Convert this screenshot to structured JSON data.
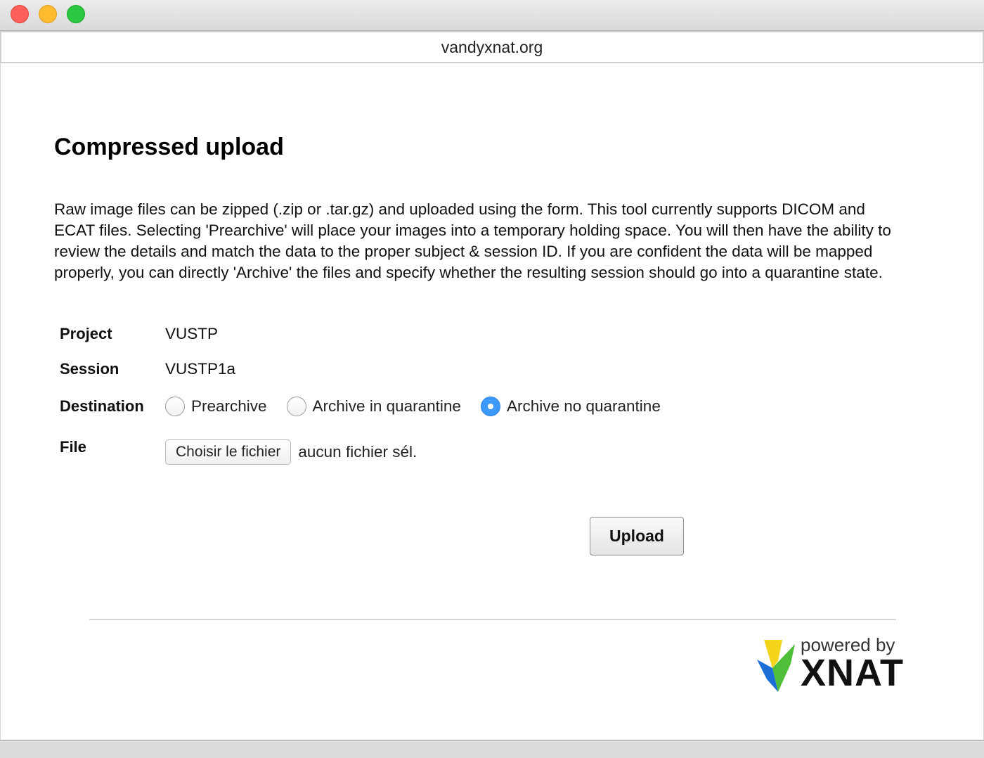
{
  "browser": {
    "url": "vandyxnat.org"
  },
  "page": {
    "title": "Compressed upload",
    "description": "Raw image files can be zipped (.zip or .tar.gz) and uploaded using the form. This tool currently supports DICOM and ECAT files. Selecting 'Prearchive' will place your images into a temporary holding space. You will then have the ability to review the details and match the data to the proper subject & session ID. If you are confident the data will be mapped properly, you can directly 'Archive' the files and specify whether the resulting session should go into a quarantine state."
  },
  "form": {
    "project_label": "Project",
    "project_value": "VUSTP",
    "session_label": "Session",
    "session_value": "VUSTP1a",
    "destination_label": "Destination",
    "destination_options": [
      {
        "label": "Prearchive",
        "checked": false
      },
      {
        "label": "Archive in quarantine",
        "checked": false
      },
      {
        "label": "Archive no quarantine",
        "checked": true
      }
    ],
    "file_label": "File",
    "file_button": "Choisir le fichier",
    "file_status": "aucun fichier sél.",
    "upload_button": "Upload"
  },
  "footer": {
    "powered_by": "powered by",
    "brand": "XNAT"
  },
  "colors": {
    "radio_selected": "#3b99fc",
    "logo_yellow": "#f4d41b",
    "logo_green": "#4fbf3a",
    "logo_blue": "#1c6fd6"
  }
}
